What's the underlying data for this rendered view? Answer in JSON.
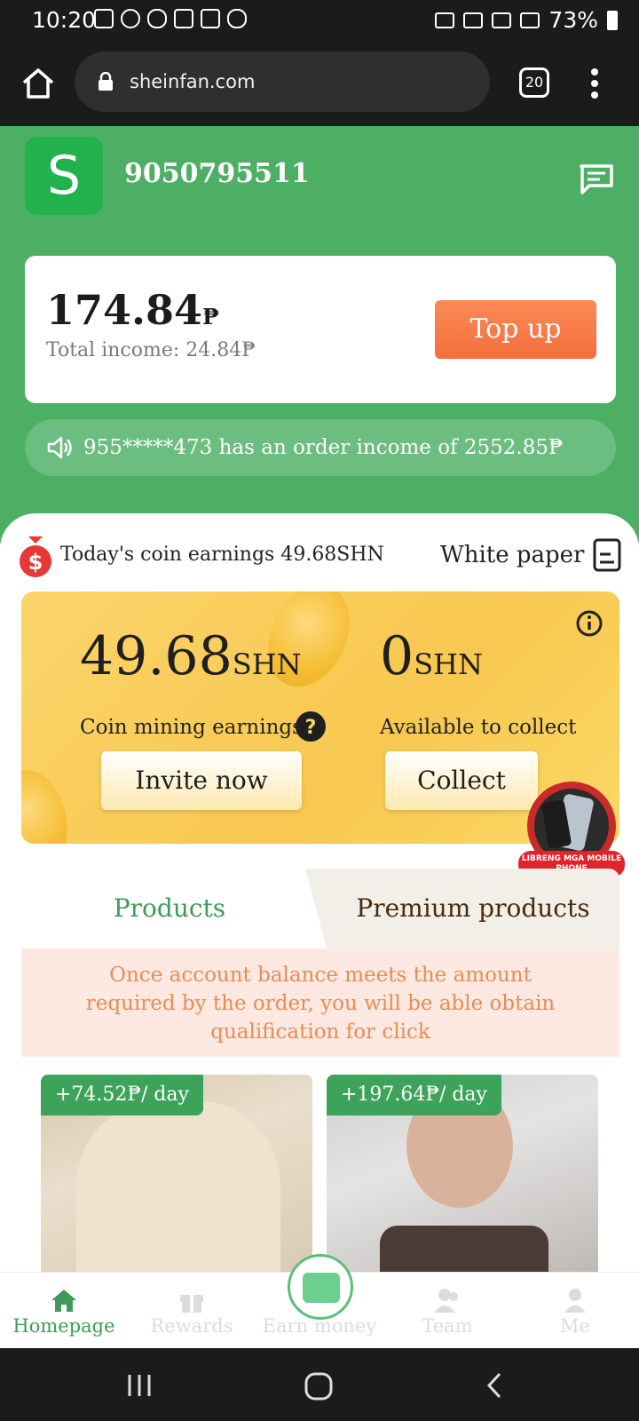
{
  "status_bar": {
    "time": "10:20",
    "battery": "73%"
  },
  "browser": {
    "url": "sheinfan.com",
    "tab_count": "20"
  },
  "header": {
    "avatar_letter": "S",
    "phone": "9050795511"
  },
  "balance_card": {
    "amount": "174.84",
    "currency": "₱",
    "total_income": "Total income: 24.84₱",
    "topup_label": "Top up"
  },
  "ticker": {
    "text": "955*****473 has an order income of 2552.85₱"
  },
  "coin_row": {
    "today_earnings": "Today's coin earnings 49.68SHN",
    "white_paper": "White paper"
  },
  "mining": {
    "mining_value": "49.68",
    "available_value": "0",
    "unit": "SHN",
    "mining_label": "Coin mining earnings",
    "available_label": "Available to collect",
    "invite_label": "Invite now",
    "collect_label": "Collect"
  },
  "promo": {
    "label": "LIBRENG MGA MOBILE PHONE"
  },
  "tabs": {
    "products": "Products",
    "premium": "Premium products"
  },
  "notice": "Once account balance meets the amount required by the order, you will be able obtain qualification for click",
  "products": [
    {
      "rate": "+74.52₱/ day"
    },
    {
      "rate": "+197.64₱/ day"
    }
  ],
  "bottom_nav": [
    {
      "label": "Homepage",
      "icon": "home-icon",
      "active": true
    },
    {
      "label": "Rewards",
      "icon": "gift-icon",
      "active": false
    },
    {
      "label": "Earn money",
      "icon": "wallet-icon",
      "active": false
    },
    {
      "label": "Team",
      "icon": "team-icon",
      "active": false
    },
    {
      "label": "Me",
      "icon": "user-icon",
      "active": false
    }
  ],
  "colors": {
    "brand_green": "#4caf64",
    "topup_orange": "#f46f3c",
    "mining_gold": "#f8c850",
    "notice_text": "#e78d52"
  }
}
